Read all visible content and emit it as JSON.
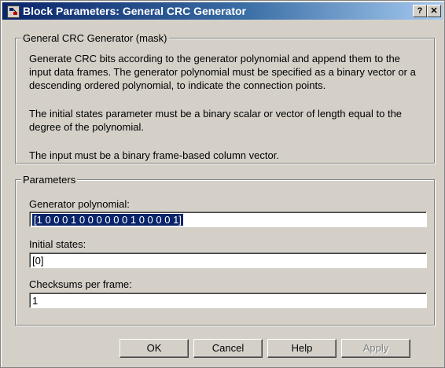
{
  "window": {
    "title": "Block Parameters: General CRC Generator",
    "help_label": "?",
    "close_label": "✕"
  },
  "mask": {
    "group_label": "General CRC Generator (mask)",
    "paragraphs": [
      "Generate CRC bits according to the generator polynomial and append them to the\ninput data frames. The generator polynomial must be specified as a binary vector or a\ndescending ordered polynomial, to indicate the connection points.",
      "The initial states parameter must be a binary scalar or vector of length equal to the\ndegree of the polynomial.",
      "The input must be a binary frame-based column vector."
    ]
  },
  "parameters": {
    "group_label": "Parameters",
    "generator_polynomial": {
      "label": "Generator polynomial:",
      "value": "[1 0 0 0 1 0 0 0 0 0 0 1 0 0 0 0 1]"
    },
    "initial_states": {
      "label": "Initial states:",
      "value": "[0]"
    },
    "checksums_per_frame": {
      "label": "Checksums per frame:",
      "value": "1"
    }
  },
  "buttons": {
    "ok": "OK",
    "cancel": "Cancel",
    "help": "Help",
    "apply": "Apply"
  },
  "icons": {
    "app_icon": "simulink-block-icon",
    "help_icon": "question-mark-icon",
    "close_icon": "close-icon"
  },
  "colors": {
    "titlebar": "#0a246a",
    "dialog_bg": "#d4d0c8",
    "selection": "#0a246a"
  }
}
